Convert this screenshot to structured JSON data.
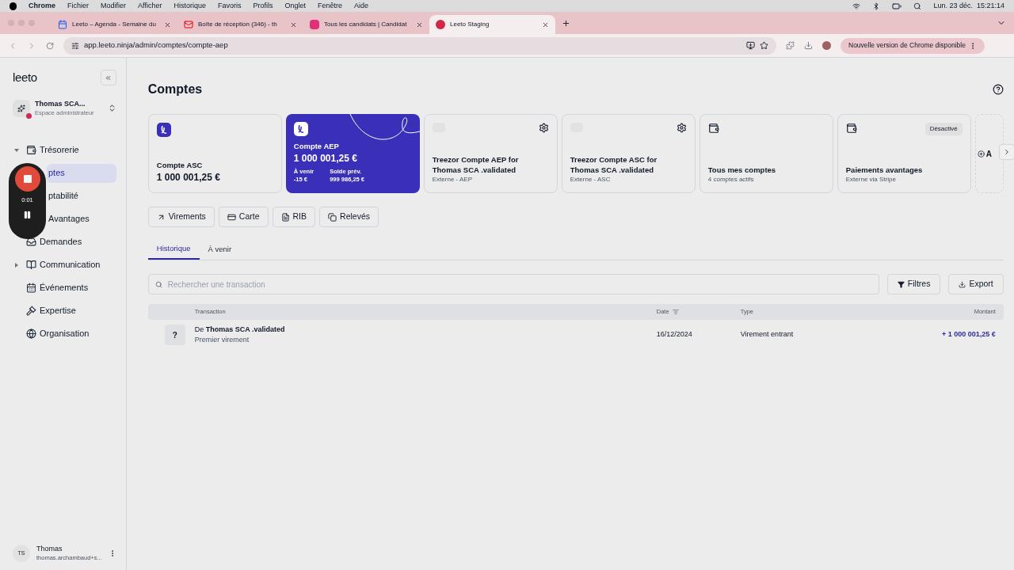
{
  "menu_bar": {
    "app": "Chrome",
    "items": [
      "Fichier",
      "Modifier",
      "Afficher",
      "Historique",
      "Favoris",
      "Profils",
      "Onglet",
      "Fenêtre",
      "Aide"
    ],
    "clock": "Lun. 23 déc.  15:21:14"
  },
  "browser_tabs": [
    {
      "title": "Leeto – Agenda - Semaine du",
      "kind": "calendar",
      "selected": false
    },
    {
      "title": "Boîte de réception (346) - th",
      "kind": "mail",
      "selected": false
    },
    {
      "title": "Tous les candidats | Candidat",
      "kind": "jobs",
      "selected": false
    },
    {
      "title": "Leeto Staging",
      "kind": "leeto",
      "selected": true
    }
  ],
  "address": "app.leeto.ninja/admin/comptes/compte-aep",
  "update_banner": "Nouvelle version de Chrome disponible",
  "sidebar": {
    "logo": "leeto",
    "workspace": {
      "name": "Thomas SCA...",
      "role": "Espace administrateur"
    },
    "items": [
      {
        "label": "Trésorerie",
        "expanded": true,
        "selected": false,
        "children": [
          {
            "label": "ptes",
            "selected": true
          },
          {
            "label": "ptabilité",
            "selected": false
          },
          {
            "label": "Avantages",
            "selected": false
          }
        ]
      },
      {
        "label": "Demandes",
        "selected": false
      },
      {
        "label": "Communication",
        "expanded": false,
        "selected": false
      },
      {
        "label": "Événements",
        "selected": false
      },
      {
        "label": "Expertise",
        "selected": false
      },
      {
        "label": "Organisation",
        "selected": false
      }
    ],
    "user": {
      "initials": "TS",
      "name": "Thomas",
      "email": "thomas.archambaud+s..."
    }
  },
  "recorder": {
    "time": "0:01"
  },
  "page_title": "Comptes",
  "accounts": [
    {
      "kind": "leeto",
      "selected": false,
      "name": "Compte ASC",
      "amount": "1 000 001,25 €"
    },
    {
      "kind": "leeto",
      "selected": true,
      "name": "Compte AEP",
      "amount": "1 000 001,25 €",
      "upcoming_label": "À venir",
      "upcoming": "-15 €",
      "forecast_label": "Solde prév.",
      "forecast": "999 986,25 €"
    },
    {
      "kind": "external",
      "selected": false,
      "name": "Treezor Compte AEP for Thomas SCA .validated",
      "subtitle": "Externe - AEP"
    },
    {
      "kind": "external",
      "selected": false,
      "name": "Treezor Compte ASC for Thomas SCA .validated",
      "subtitle": "Externe - ASC"
    },
    {
      "kind": "wallet",
      "selected": false,
      "name": "Tous mes comptes",
      "subtitle": "4 comptes actifs"
    },
    {
      "kind": "wallet",
      "selected": false,
      "name": "Paiements avantages",
      "subtitle": "Externe via Stripe",
      "badge": "Désactivé"
    },
    {
      "kind": "add",
      "name": "A"
    }
  ],
  "actions": [
    {
      "label": "Virements"
    },
    {
      "label": "Carte"
    },
    {
      "label": "RIB"
    },
    {
      "label": "Relevés"
    }
  ],
  "tabs": [
    {
      "label": "Historique",
      "selected": true
    },
    {
      "label": "À venir",
      "selected": false
    }
  ],
  "search": {
    "placeholder": "Rechercher une transaction"
  },
  "filter_button": "Filtres",
  "export_button": "Export",
  "table": {
    "columns": [
      "Transaction",
      "Date",
      "Type",
      "Montant"
    ],
    "rows": [
      {
        "icon": "?",
        "prefix": "De",
        "counterparty": "Thomas SCA .validated",
        "note": "Premier virement",
        "date": "16/12/2024",
        "type": "Virement entrant",
        "amount": "+ 1 000 001,25 €"
      }
    ]
  }
}
